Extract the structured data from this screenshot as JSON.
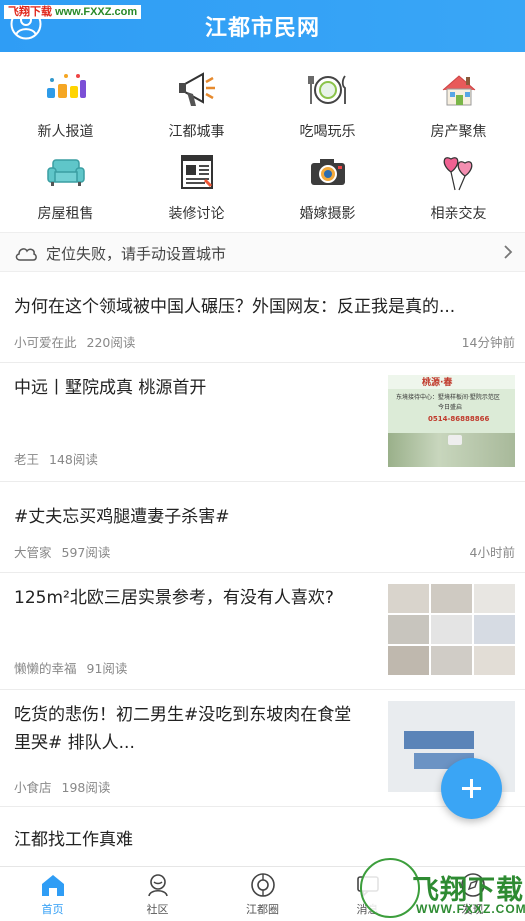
{
  "header": {
    "title": "江都市民网",
    "watermark": {
      "part1": "飞翔下载",
      "part2": "www.FXXZ.com"
    }
  },
  "categories": [
    {
      "label": "新人报道",
      "icon": "new-member-icon"
    },
    {
      "label": "江都城事",
      "icon": "megaphone-icon"
    },
    {
      "label": "吃喝玩乐",
      "icon": "dining-plate-icon"
    },
    {
      "label": "房产聚焦",
      "icon": "house-icon"
    },
    {
      "label": "房屋租售",
      "icon": "sofa-icon"
    },
    {
      "label": "装修讨论",
      "icon": "blueprint-icon"
    },
    {
      "label": "婚嫁摄影",
      "icon": "camera-icon"
    },
    {
      "label": "相亲交友",
      "icon": "heart-balloon-icon"
    }
  ],
  "location": {
    "message": "定位失败，请手动设置城市"
  },
  "feed": [
    {
      "title": "为何在这个领域被中国人碾压？外国网友：反正我是真的...",
      "author": "小可爱在此",
      "reads": "220阅读",
      "time": "14分钟前"
    },
    {
      "title": "中远丨墅院成真 桃源首开",
      "author": "老王",
      "reads": "148阅读",
      "time": "",
      "thumb": {
        "headline": "桃源·春",
        "line1": "东境接待中心：墅境样板间·墅院示范区",
        "line2": "今日盛启",
        "phone": "0514-86888866"
      }
    },
    {
      "title": "#丈夫忘买鸡腿遭妻子杀害#",
      "author": "大管家",
      "reads": "597阅读",
      "time": "4小时前"
    },
    {
      "title": "125m²北欧三居实景参考，有没有人喜欢?",
      "author": "懒懒的幸福",
      "reads": "91阅读",
      "time": ""
    },
    {
      "title_line1": "吃货的悲伤！初二男生#没吃到东坡肉在食堂",
      "title_line2": "里哭# 排队人...",
      "author": "小食店",
      "reads": "198阅读",
      "time": ""
    },
    {
      "title": "江都找工作真难",
      "author": "",
      "reads": "",
      "time": ""
    }
  ],
  "bottom_nav": [
    {
      "label": "首页",
      "icon": "home-icon",
      "active": true
    },
    {
      "label": "社区",
      "icon": "community-icon",
      "active": false
    },
    {
      "label": "江都圈",
      "icon": "circle-icon",
      "active": false
    },
    {
      "label": "消息",
      "icon": "message-icon",
      "active": false
    },
    {
      "label": "发现",
      "icon": "discover-icon",
      "active": false
    }
  ],
  "bottom_watermark": {
    "brand": "飞翔下载",
    "url": "WWW.FXXZ.COM"
  },
  "colors": {
    "primary": "#2f9df5",
    "text": "#222222",
    "meta": "#888888"
  }
}
